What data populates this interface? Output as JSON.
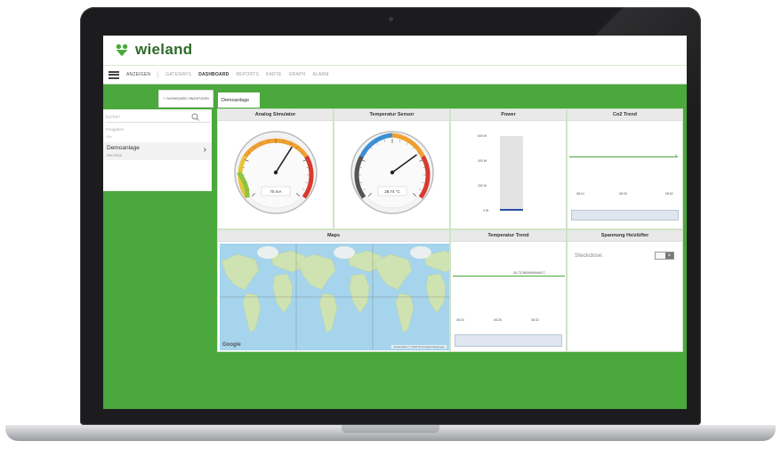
{
  "brand": {
    "name": "wieland",
    "color": "#2f6b2a",
    "accent": "#4aa83c"
  },
  "nav": {
    "menu_label": "ANZEIGEN",
    "items": [
      {
        "label": "GATEWAYS",
        "active": false
      },
      {
        "label": "DASHBOARD",
        "active": true
      },
      {
        "label": "REPORTS",
        "active": false
      },
      {
        "label": "KARTE",
        "active": false
      },
      {
        "label": "GRAPH",
        "active": false
      },
      {
        "label": "ALARM",
        "active": false
      }
    ]
  },
  "sidebar": {
    "add_button": "DASHBOARD HINZUFÜGEN",
    "search_placeholder": "Suchen",
    "folder_label": "Freigaben",
    "folder_all": "Alle",
    "item_title": "Demoanlage",
    "item_sub": "WN 2018"
  },
  "dashboard": {
    "tab": "Demoanlage"
  },
  "widgets": {
    "analog": {
      "title": "Analog Simulator",
      "value_text": "75 mA",
      "value_fraction": 0.62
    },
    "temp": {
      "title": "Temperatur Sensor",
      "value_text": "28.74 °C",
      "value_fraction": 0.7
    },
    "power": {
      "title": "Power",
      "ticks": [
        "600 W",
        "400 W",
        "200 W",
        "0 W"
      ],
      "value": 0
    },
    "co2": {
      "title": "Co2 Trend",
      "times": [
        "08:14",
        "08:33",
        "08:52"
      ],
      "last_value": "0"
    },
    "maps": {
      "title": "Maps",
      "google": "Google",
      "attribution": "Kartendaten © 2018   Nutzungsbedingungen"
    },
    "temp_trend": {
      "title": "Temperatur Trend",
      "times": [
        "08:24",
        "08:28",
        "08:32"
      ],
      "last_value": "28.73786099999466°C"
    },
    "heater": {
      "title": "Spannung Heizlüfter",
      "label": "Steckdose:",
      "toggle_state": "off"
    }
  },
  "icons": {
    "menu": "hamburger-icon",
    "search": "search-icon",
    "chevron": "chevron-right-icon",
    "close": "close-icon"
  }
}
